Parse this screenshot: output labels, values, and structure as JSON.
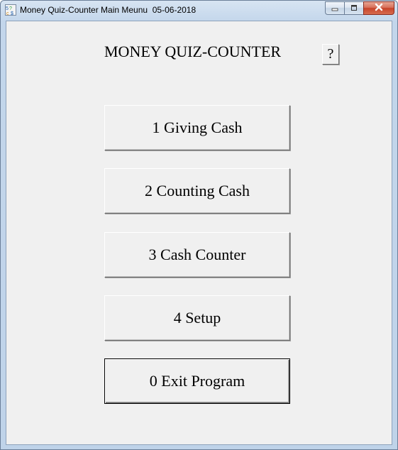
{
  "window": {
    "title": "Money Quiz-Counter Main Meunu  05-06-2018",
    "icon": "app-icon",
    "controls": {
      "minimize_icon": "minimize-icon",
      "maximize_icon": "maximize-icon",
      "close_icon": "close-icon"
    }
  },
  "main": {
    "heading": "MONEY QUIZ-COUNTER",
    "help_label": "?",
    "buttons": [
      {
        "label": "1 Giving Cash"
      },
      {
        "label": "2 Counting Cash"
      },
      {
        "label": "3 Cash Counter"
      },
      {
        "label": "4 Setup"
      },
      {
        "label": "0 Exit Program"
      }
    ]
  },
  "colors": {
    "client_background": "#f0f0f0",
    "title_gradient_top": "#d7e4f2",
    "close_button": "#c7432a"
  }
}
